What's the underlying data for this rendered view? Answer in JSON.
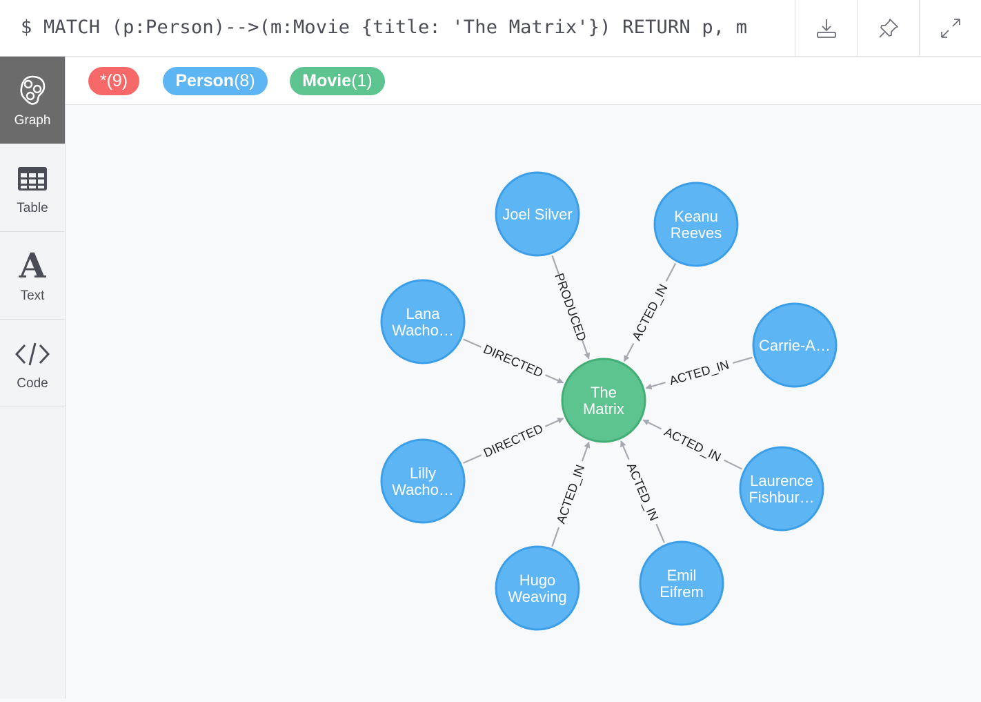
{
  "query": {
    "prompt": "$",
    "text": "MATCH (p:Person)-->(m:Movie {title: 'The Matrix'}) RETURN p, m"
  },
  "toolbar": {
    "download_icon": "download-icon",
    "pin_icon": "pin-icon",
    "expand_icon": "expand-icon"
  },
  "sidebar": {
    "items": [
      {
        "label": "Graph",
        "icon": "graph-icon",
        "active": true
      },
      {
        "label": "Table",
        "icon": "table-icon",
        "active": false
      },
      {
        "label": "Text",
        "icon": "text-icon",
        "active": false
      },
      {
        "label": "Code",
        "icon": "code-icon",
        "active": false
      }
    ]
  },
  "filters": [
    {
      "name": "*",
      "count": "(9)",
      "color": "#f76868"
    },
    {
      "name": "Person",
      "count": "(8)",
      "color": "#5db6f3"
    },
    {
      "name": "Movie",
      "count": "(1)",
      "color": "#5ec48f"
    }
  ],
  "colors": {
    "person_fill": "#5db6f3",
    "person_stroke": "#3c9ee6",
    "movie_fill": "#5ec48f",
    "movie_stroke": "#43ad76",
    "edge": "#a6a9b0"
  },
  "graph": {
    "center": {
      "lines": [
        "The",
        "Matrix"
      ]
    },
    "nodes": [
      {
        "id": "joel",
        "lines": [
          "Joel Silver"
        ],
        "rel": "PRODUCED"
      },
      {
        "id": "keanu",
        "lines": [
          "Keanu",
          "Reeves"
        ],
        "rel": "ACTED_IN"
      },
      {
        "id": "carrie",
        "lines": [
          "Carrie-A…"
        ],
        "rel": "ACTED_IN"
      },
      {
        "id": "laurence",
        "lines": [
          "Laurence",
          "Fishbur…"
        ],
        "rel": "ACTED_IN"
      },
      {
        "id": "emil",
        "lines": [
          "Emil",
          "Eifrem"
        ],
        "rel": "ACTED_IN"
      },
      {
        "id": "hugo",
        "lines": [
          "Hugo",
          "Weaving"
        ],
        "rel": "ACTED_IN"
      },
      {
        "id": "lilly",
        "lines": [
          "Lilly",
          "Wacho…"
        ],
        "rel": "DIRECTED"
      },
      {
        "id": "lana",
        "lines": [
          "Lana",
          "Wacho…"
        ],
        "rel": "DIRECTED"
      }
    ]
  }
}
